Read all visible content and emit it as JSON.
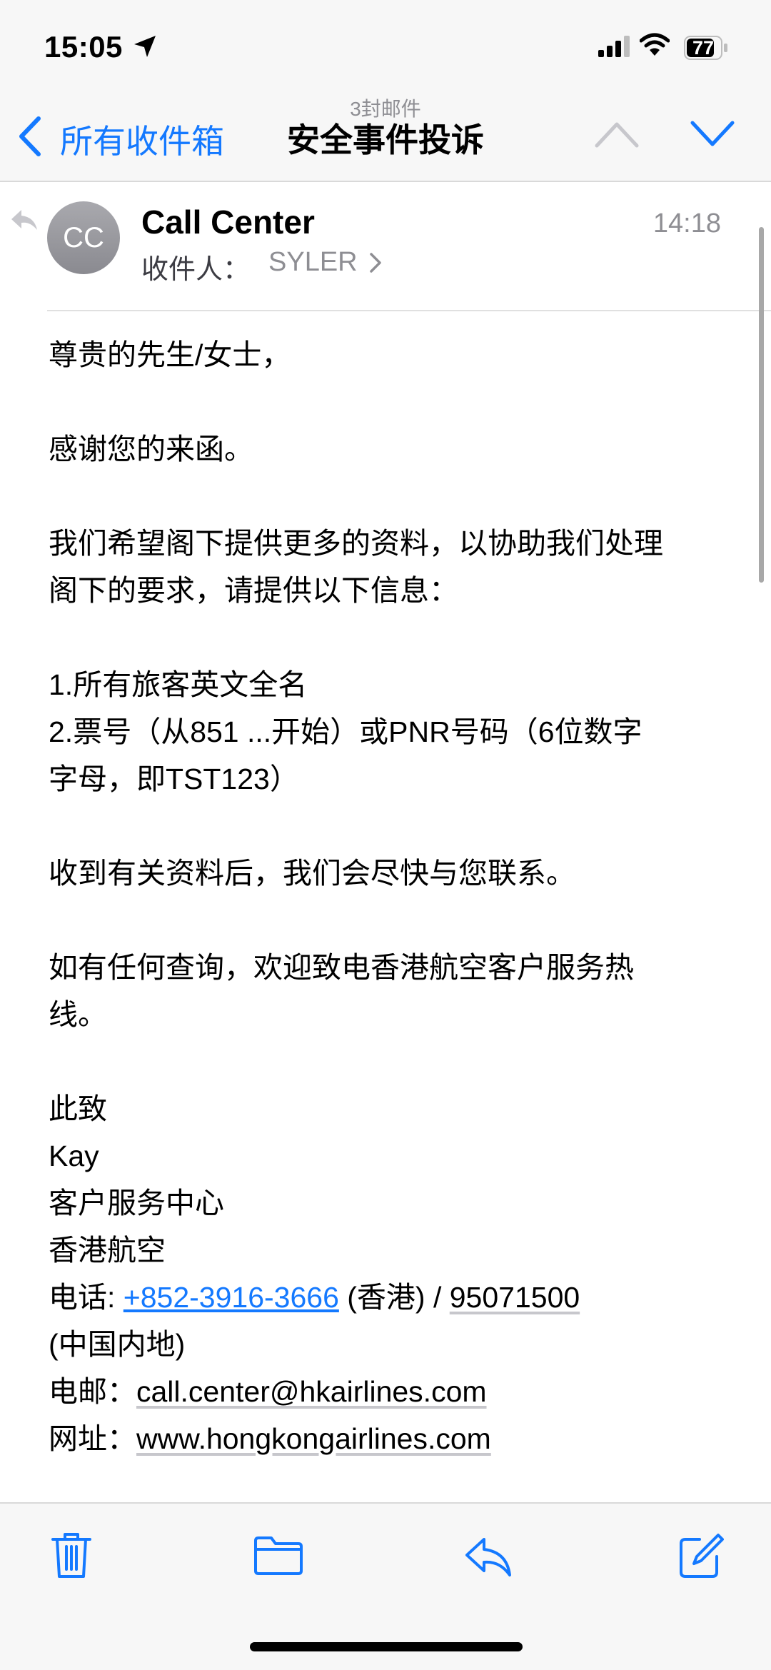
{
  "status_bar": {
    "time": "15:05",
    "battery": "77"
  },
  "nav": {
    "back_label": "所有收件箱",
    "message_count": "3封邮件",
    "subject": "安全事件投诉"
  },
  "header": {
    "avatar_initials": "CC",
    "sender": "Call Center",
    "time": "14:18",
    "to_label": "收件人：",
    "to_name": "SYLER"
  },
  "body": {
    "greeting": "尊贵的先生/女士，",
    "thanks": "感谢您的来函。",
    "request_line1": "我们希望阁下提供更多的资料，以协助我们处理",
    "request_line2": "阁下的要求，请提供以下信息：",
    "item1": "1.所有旅客英文全名",
    "item2_line1": "2.票号（从851 ...开始）或PNR号码（6位数字",
    "item2_line2": "字母，即TST123）",
    "followup": "收到有关资料后，我们会尽快与您联系。",
    "inquiry_line1": "如有任何查询，欢迎致电香港航空客户服务热",
    "inquiry_line2": "线。",
    "closing": "此致",
    "agent": "Kay",
    "dept": "客户服务中心",
    "company": "香港航空",
    "phone_label": "电话: ",
    "phone_hk": "+852-3916-3666",
    "phone_hk_suffix": " (香港) / ",
    "phone_cn": "95071500",
    "phone_cn_suffix": "(中国内地)",
    "email_label": "电邮：",
    "email": "call.center@hkairlines.com",
    "web_label": "网址：",
    "website": "www.hongkongairlines.com"
  },
  "colors": {
    "accent": "#1479ff",
    "secondary_text": "#8e8e93"
  },
  "icons": {
    "nav": [
      "chevron-left-icon",
      "chevron-up-icon",
      "chevron-down-icon"
    ],
    "toolbar": [
      "trash-icon",
      "folder-icon",
      "reply-icon",
      "compose-icon"
    ]
  }
}
